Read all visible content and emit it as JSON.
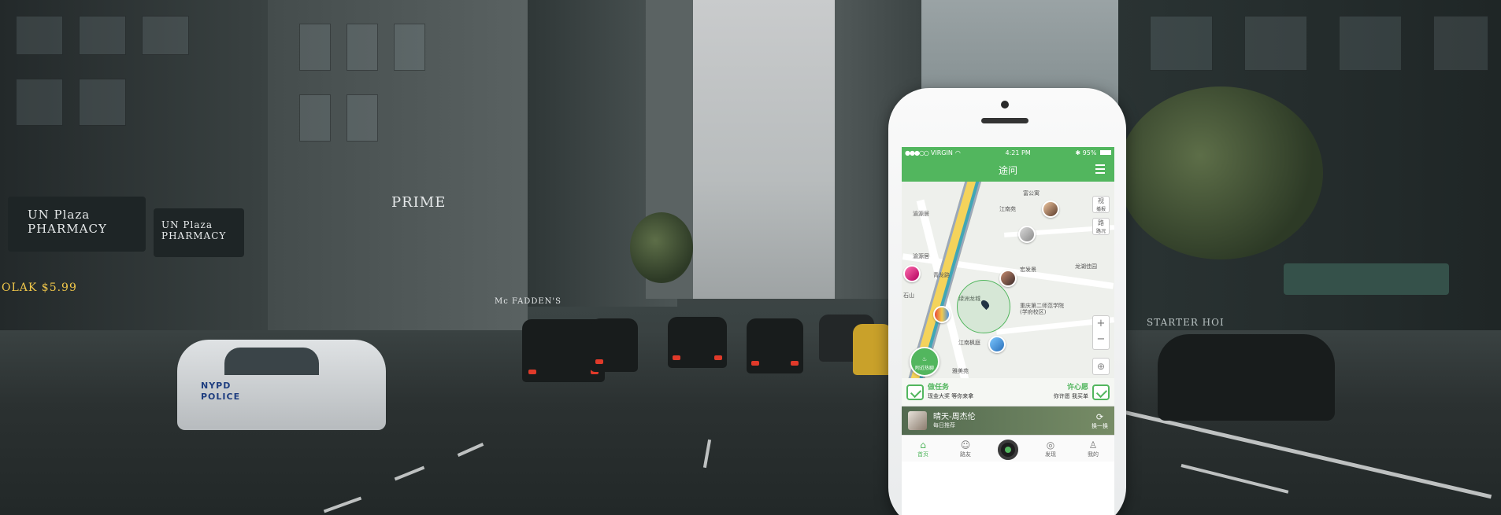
{
  "background": {
    "storefront_signs": [
      "UN Plaza PHARMACY",
      "UN Plaza PHARMACY",
      "PRIME",
      "Mc FADDEN'S",
      "STARTER HOI"
    ],
    "police_car": {
      "line1": "NYPD",
      "line2": "POLICE"
    },
    "price_sign": "OLAK $5.99"
  },
  "phone": {
    "status": {
      "carrier": "VIRGIN",
      "time": "4:21 PM",
      "battery": "95%"
    },
    "app_title": "途问",
    "map": {
      "labels": [
        "渝源居",
        "江南苑",
        "渝源居",
        "青龙路",
        "石山",
        "绿洲龙城",
        "重庆第二师范学院(学府校区)",
        "江南枫庭",
        "宏发景",
        "龙湖佳园",
        "雅美苑",
        "富公寓"
      ],
      "side_buttons": [
        {
          "icon": "视",
          "label": "播报"
        },
        {
          "icon": "路",
          "label": "路况"
        }
      ],
      "zoom_in": "+",
      "zoom_out": "−",
      "hot_button": {
        "icon": "♨",
        "label": "附近热聊"
      }
    },
    "tasks": [
      {
        "title": "做任务",
        "sub": "现金大奖 等你来拿"
      },
      {
        "title": "许心愿",
        "sub": "你许愿 我买单"
      }
    ],
    "music": {
      "title": "晴天-周杰伦",
      "sub": "每日推荐",
      "switch_label": "换一换",
      "switch_icon": "⟳"
    },
    "tabs": [
      {
        "label": "首页",
        "icon": "⌂"
      },
      {
        "label": "路友",
        "icon": "☺"
      },
      {
        "label": "",
        "icon": ""
      },
      {
        "label": "发现",
        "icon": "◎"
      },
      {
        "label": "我的",
        "icon": "♙"
      }
    ]
  },
  "colors": {
    "accent": "#52b65e",
    "road_yellow": "#f4d35b"
  }
}
